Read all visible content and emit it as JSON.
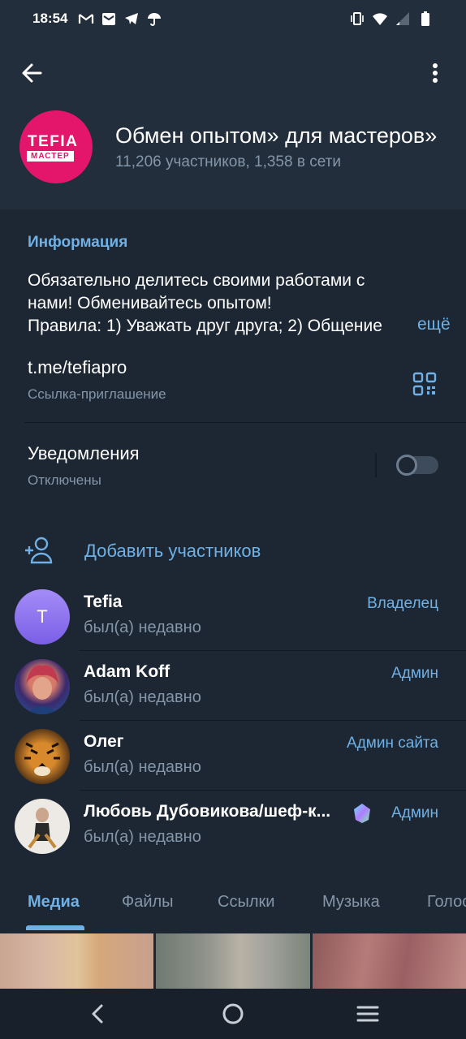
{
  "status_bar": {
    "time": "18:54",
    "left_icons": [
      "gmail-icon",
      "mail-icon",
      "telegram-icon",
      "umbrella-icon"
    ],
    "right_icons": [
      "vibrate-icon",
      "wifi-icon",
      "signal-icon",
      "battery-icon"
    ]
  },
  "header": {
    "title": "«Обмен опытом» для мастеров",
    "subtitle": "11,206 участников, 1,358 в сети",
    "avatar_line1": "TEFIA",
    "avatar_line2": "МАСТЕР",
    "avatar_color": "#e3166b"
  },
  "info": {
    "section_title": "Информация",
    "about_line1": "Обязательно делитесь своими работами с",
    "about_line2": "нами! Обменивайтесь опытом!",
    "about_line3": "Правила: 1) Уважать друг друга; 2) Общение",
    "more_label": "ещё",
    "link": "t.me/tefiapro",
    "link_caption": "Ссылка-приглашение",
    "notifications_title": "Уведомления",
    "notifications_status": "Отключены",
    "notifications_enabled": false
  },
  "members": {
    "add_label": "Добавить участников",
    "list": [
      {
        "initial": "T",
        "name": "Tefia",
        "status": "был(а) недавно",
        "role": "Владелец"
      },
      {
        "name": "Adam Koff",
        "status": "был(а) недавно",
        "role": "Админ"
      },
      {
        "name": "Олег",
        "status": "был(а) недавно",
        "role": "Админ сайта"
      },
      {
        "name": "Любовь Дубовикова/шеф-к...",
        "status": "был(а) недавно",
        "role": "Админ"
      }
    ]
  },
  "tabs": [
    "Медиа",
    "Файлы",
    "Ссылки",
    "Музыка",
    "Голосовые"
  ],
  "active_tab": "Медиа",
  "colors": {
    "background": "#1d2733",
    "header_bg": "#222e3b",
    "accent": "#6fb1e6",
    "secondary_text": "#8496a8"
  }
}
